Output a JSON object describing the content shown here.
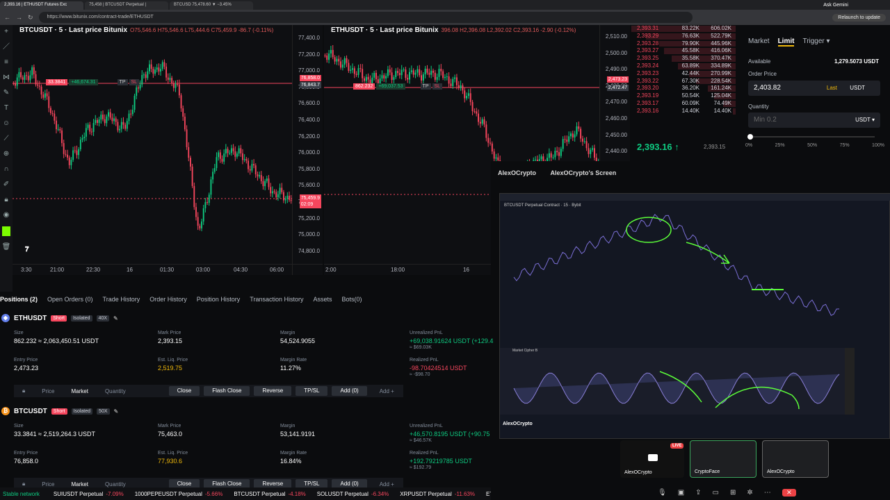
{
  "browser": {
    "tabs": [
      "2,393.16 | ETHUSDT Futures Exc",
      "75,458 | BTCUSDT Perpetual |",
      "BTCUSD 75,478.60 ▼ −3.45%"
    ],
    "url": "https://www.bitunix.com/contract-trade/ETHUSDT",
    "ask": "Ask Gemini",
    "relaunch": "Relaunch to update"
  },
  "btc_chart": {
    "title": "BTCUSDT · 5 · Last price Bitunix",
    "ohlc": "O75,546.6 H75,546.6 L75,444.6 C75,459.9 -86.7 (-0.11%)",
    "y_ticks": [
      "77,400.0",
      "77,200.0",
      "77,000.0",
      "76,800.0",
      "76,600.0",
      "76,400.0",
      "76,200.0",
      "76,000.0",
      "75,800.0",
      "75,600.0",
      "75,400.0",
      "75,200.0",
      "75,000.0",
      "74,800.0"
    ],
    "x_ticks": [
      "3:30",
      "21:00",
      "22:30",
      "16",
      "01:30",
      "03:00",
      "04:30",
      "06:00"
    ],
    "entry_qty": "33.3841",
    "pnl_tag": "+46,674.31",
    "tp": "TP",
    "sl": "SL",
    "entry_price_tag": "76,858.0",
    "mark_tag": "76,843.7",
    "last_tag": "75,459.9",
    "timer": "02:09"
  },
  "eth_chart": {
    "title": "ETHUSDT · 5 · Last price Bitunix",
    "ohlc": "396.08 H2,396.08 L2,392.02 C2,393.16 -2.90 (-0.12%)",
    "y_ticks": [
      "2,510.00",
      "2,500.00",
      "2,490.00",
      "2,480.00",
      "2,470.00",
      "2,460.00",
      "2,450.00",
      "2,440.00",
      "2,430.00"
    ],
    "x_ticks": [
      "2:00",
      "18:00",
      "16"
    ],
    "entry_qty": "862.232",
    "pnl_tag": "+69,037.53",
    "tp": "TP",
    "sl": "SL",
    "entry_tag": "2,473.23",
    "mark_tag": "2,472.47"
  },
  "orderbook": {
    "rows": [
      {
        "p": "2,393.31",
        "a": "83.22K",
        "t": "606.02K"
      },
      {
        "p": "2,393.29",
        "a": "76.63K",
        "t": "522.79K"
      },
      {
        "p": "2,393.28",
        "a": "79.90K",
        "t": "445.96K"
      },
      {
        "p": "2,393.27",
        "a": "45.58K",
        "t": "416.06K"
      },
      {
        "p": "2,393.25",
        "a": "35.58K",
        "t": "370.47K"
      },
      {
        "p": "2,393.24",
        "a": "63.89K",
        "t": "334.89K"
      },
      {
        "p": "2,393.23",
        "a": "42.44K",
        "t": "270.99K"
      },
      {
        "p": "2,393.22",
        "a": "67.30K",
        "t": "228.54K"
      },
      {
        "p": "2,393.20",
        "a": "36.20K",
        "t": "161.24K"
      },
      {
        "p": "2,393.19",
        "a": "50.54K",
        "t": "125.04K"
      },
      {
        "p": "2,393.17",
        "a": "60.09K",
        "t": "74.49K"
      },
      {
        "p": "2,393.16",
        "a": "14.40K",
        "t": "14.40K"
      }
    ],
    "last": "2,393.16 ↑",
    "mark": "2,393.15"
  },
  "order_form": {
    "tabs": [
      "Market",
      "Limit",
      "Trigger ▾"
    ],
    "available_label": "Available",
    "available_value": "1,279.5073 USDT",
    "price_label": "Order Price",
    "price_value": "2,403.82",
    "last": "Last",
    "unit": "USDT",
    "qty_label": "Quantity",
    "qty_placeholder": "Min 0.2",
    "qty_unit": "USDT ▾",
    "pcts": [
      "0%",
      "25%",
      "50%",
      "75%",
      "100%"
    ]
  },
  "overlay": {
    "viewer": "AlexOCrypto",
    "screen": "AlexOCrypto's Screen",
    "inner_title": "BTCUSDT Perpetual Contract · 15 · Bybit",
    "osc_title": "Market Cipher B",
    "streamer": "AlexOCrypto"
  },
  "positions_tabs": [
    "Positions (2)",
    "Open Orders (0)",
    "Trade History",
    "Order History",
    "Position History",
    "Transaction History",
    "Assets",
    "Bots(0)"
  ],
  "positions": [
    {
      "symbol": "ETHUSDT",
      "side": "Short",
      "mode": "Isolated",
      "lev": "40X",
      "size_label": "Size",
      "size": "862.232 ≈ 2,063,450.51 USDT",
      "mark_label": "Mark Price",
      "mark": "2,393.15",
      "margin_label": "Margin",
      "margin": "54,524.9055",
      "upnl_label": "Unrealized PnL",
      "upnl": "+69,038.91624 USDT (+129.4",
      "upnl_sub": "≈ $69.03K",
      "entry_label": "Entry Price",
      "entry": "2,473.23",
      "liq_label": "Est. Liq. Price",
      "liq": "2,519.75",
      "rate_label": "Margin Rate",
      "rate": "11.27%",
      "rpnl_label": "Realized PnL",
      "rpnl": "-98.70424514 USDT",
      "rpnl_sub": "≈ -$98.70"
    },
    {
      "symbol": "BTCUSDT",
      "side": "Short",
      "mode": "Isolated",
      "lev": "50X",
      "size_label": "Size",
      "size": "33.3841 ≈ 2,519,264.3 USDT",
      "mark_label": "Mark Price",
      "mark": "75,463.0",
      "margin_label": "Margin",
      "margin": "53,141.9191",
      "upnl_label": "Unrealized PnL",
      "upnl": "+46,570.8195 USDT (+90.75",
      "upnl_sub": "≈ $46.57K",
      "entry_label": "Entry Price",
      "entry": "76,858.0",
      "liq_label": "Est. Liq. Price",
      "liq": "77,930.6",
      "rate_label": "Margin Rate",
      "rate": "16.84%",
      "rpnl_label": "Realized PnL",
      "rpnl": "+192.79219785 USDT",
      "rpnl_sub": "≈ $192.79"
    }
  ],
  "action_row": {
    "price": "Price",
    "market": "Market",
    "qty": "Quantity",
    "close": "Close",
    "flash": "Flash Close",
    "reverse": "Reverse",
    "tpsl": "TP/SL",
    "add0": "Add (0)",
    "add": "Add +"
  },
  "ticker": [
    {
      "label": "Stable network",
      "chg": ""
    },
    {
      "label": "SUIUSDT Perpetual",
      "chg": "-7.09%"
    },
    {
      "label": "1000PEPEUSDT Perpetual",
      "chg": "-5.66%"
    },
    {
      "label": "BTCUSDT Perpetual",
      "chg": "-4.18%"
    },
    {
      "label": "SOLUSDT Perpetual",
      "chg": "-6.34%"
    },
    {
      "label": "XRPUSDT Perpetual",
      "chg": "-11.63%"
    },
    {
      "label": "ETHU",
      "chg": ""
    }
  ],
  "call": {
    "live": "LIVE",
    "tile1": "AlexOCrypto",
    "tile2": "CryptoFace",
    "tile3": "AlexOCrypto"
  },
  "colors": {
    "up": "#0ecb81",
    "down": "#f6465d",
    "accent": "#f0b90b"
  }
}
